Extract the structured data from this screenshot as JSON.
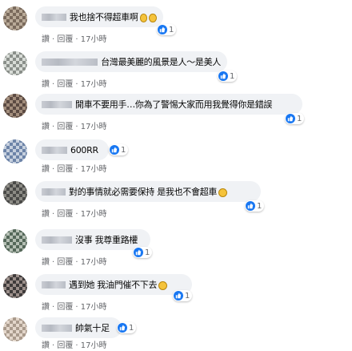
{
  "comments": [
    {
      "text": "我也捨不得超車啊",
      "emoji": true,
      "reactions": "1",
      "actions": {
        "like": "讚",
        "reply": "回覆",
        "time": "17小時"
      }
    },
    {
      "text": "台灣最美麗的風景是人～是美人",
      "emoji": false,
      "reactions": "1",
      "actions": {
        "like": "讚",
        "reply": "回覆",
        "time": "17小時"
      }
    },
    {
      "text": "開車不要用手…你為了警惕大家而用我覺得你是錯誤",
      "emoji": false,
      "reactions": "1",
      "actions": {
        "like": "讚",
        "reply": "回覆",
        "time": "17小時"
      }
    },
    {
      "text": "600RR",
      "emoji": false,
      "reactions": "1",
      "actions": {
        "like": "讚",
        "reply": "回覆",
        "time": "17小時"
      }
    },
    {
      "text": "對的事情就必需要保持 是我也不會超車",
      "emoji": true,
      "reactions": "1",
      "actions": {
        "like": "讚",
        "reply": "回覆",
        "time": "17小時"
      }
    },
    {
      "text": "沒事 我尊重路權",
      "emoji": false,
      "reactions": "1",
      "actions": {
        "like": "讚",
        "reply": "回覆",
        "time": "17小時"
      }
    },
    {
      "text": "遇到她 我油門催不下去",
      "emoji": true,
      "reactions": "1",
      "actions": {
        "like": "讚",
        "reply": "回覆",
        "time": "17小時"
      }
    },
    {
      "text": "帥氣十足",
      "emoji": false,
      "reactions": "1",
      "actions": {
        "like": "讚",
        "reply": "回覆",
        "time": "17小時"
      }
    }
  ],
  "colors": {
    "bubble": "#f0f2f5",
    "like_blue": "#1877f2",
    "meta_text": "#65676b",
    "comment_text": "#050505"
  },
  "icons": {
    "avatar": "pixelated-avatar",
    "reaction": "thumbs-up-icon",
    "emoji": "laughing-emoji-icon"
  }
}
